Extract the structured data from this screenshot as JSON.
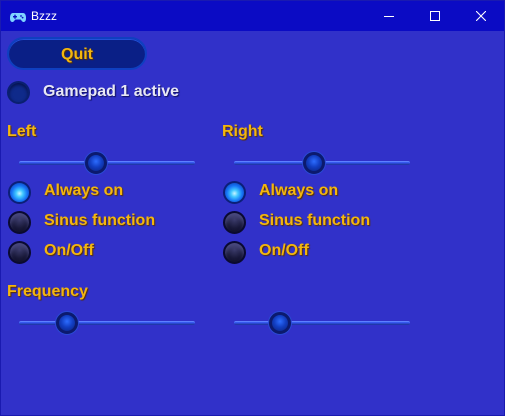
{
  "window": {
    "title": "Bzzz"
  },
  "quit_button": {
    "label": "Quit"
  },
  "gamepad": {
    "label": "Gamepad 1 active",
    "active": false
  },
  "left": {
    "heading": "Left",
    "intensity": 0.43,
    "modes": [
      {
        "label": "Always on",
        "selected": true
      },
      {
        "label": "Sinus function",
        "selected": false
      },
      {
        "label": "On/Off",
        "selected": false
      }
    ]
  },
  "right": {
    "heading": "Right",
    "intensity": 0.45,
    "modes": [
      {
        "label": "Always on",
        "selected": true
      },
      {
        "label": "Sinus function",
        "selected": false
      },
      {
        "label": "On/Off",
        "selected": false
      }
    ]
  },
  "frequency": {
    "heading": "Frequency",
    "left_value": 0.24,
    "right_value": 0.23
  },
  "colors": {
    "background": "#3131c9",
    "titlebar": "#0b0bc4",
    "accent_text": "#f3b60e"
  },
  "icons": {
    "app": "gamepad-icon",
    "minimize": "minimize-icon",
    "maximize": "maximize-icon",
    "close": "close-icon"
  }
}
